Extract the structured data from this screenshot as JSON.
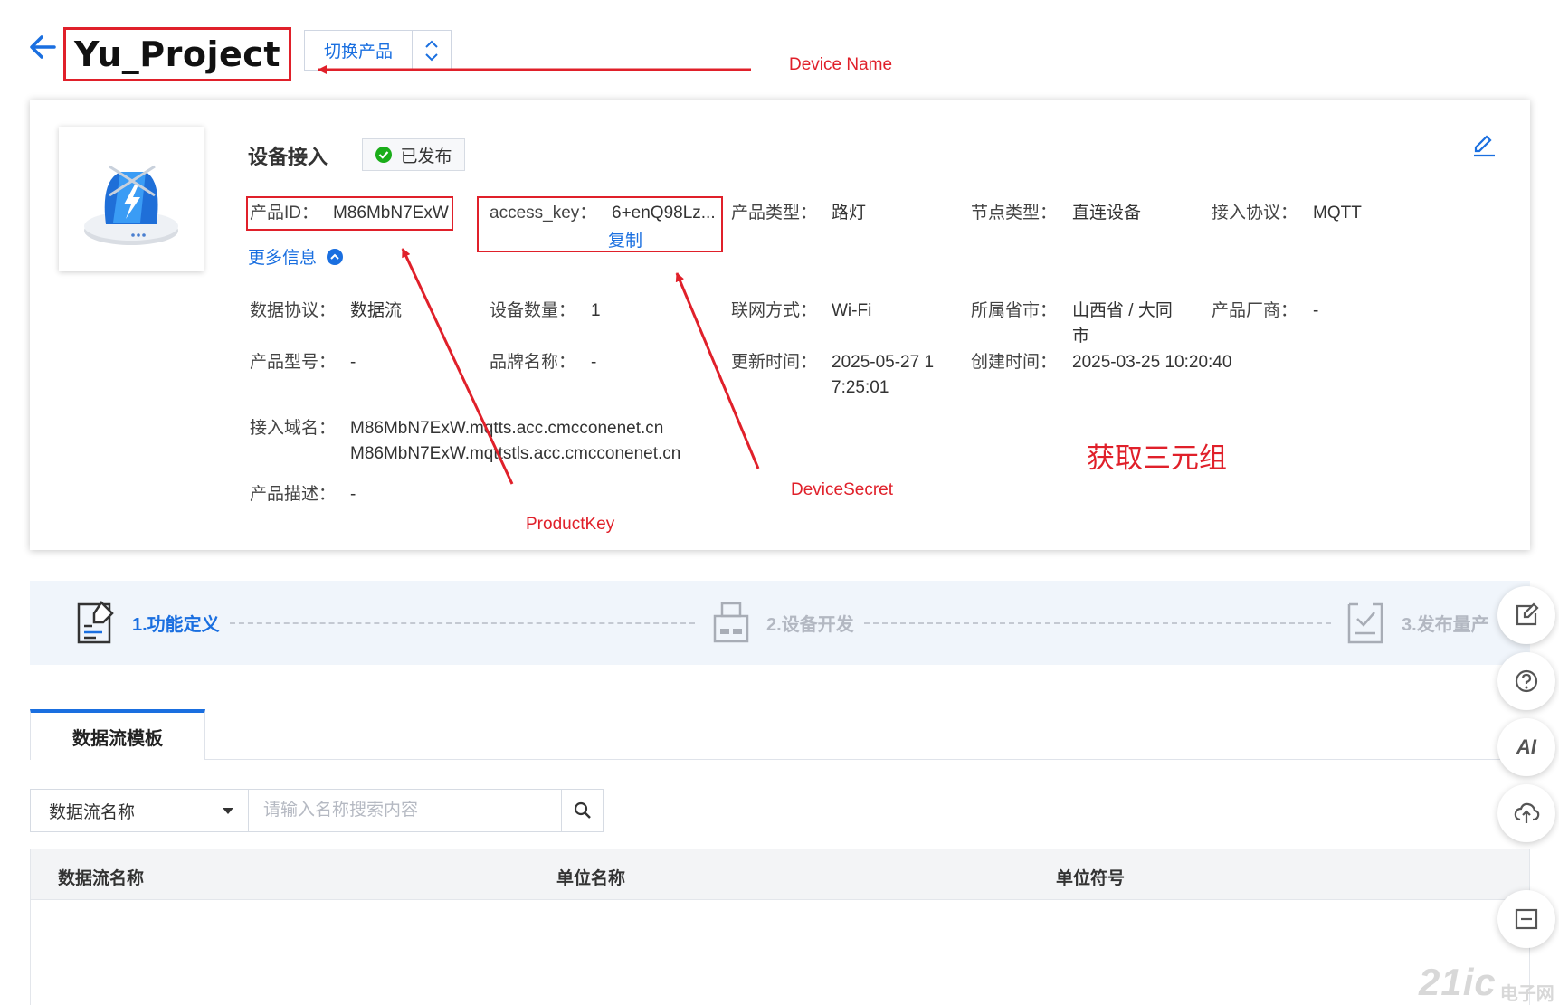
{
  "header": {
    "title": "Yu_Project",
    "switch_label": "切换产品"
  },
  "annotations": {
    "device_name": "Device Name",
    "product_key": "ProductKey",
    "device_secret": "DeviceSecret",
    "get_triple": "获取三元组",
    "color": "#e0202a"
  },
  "card": {
    "section_title": "设备接入",
    "status_badge": "已发布",
    "more_info": "更多信息",
    "copy": "复制",
    "fields": {
      "product_id": {
        "label": "产品ID：",
        "value": "M86MbN7ExW"
      },
      "access_key": {
        "label": "access_key：",
        "value": "6+enQ98Lz..."
      },
      "product_type": {
        "label": "产品类型：",
        "value": "路灯"
      },
      "node_type": {
        "label": "节点类型：",
        "value": "直连设备"
      },
      "protocol": {
        "label": "接入协议：",
        "value": "MQTT"
      },
      "data_protocol": {
        "label": "数据协议：",
        "value": "数据流"
      },
      "device_count": {
        "label": "设备数量：",
        "value": "1"
      },
      "network": {
        "label": "联网方式：",
        "value": "Wi-Fi"
      },
      "region": {
        "label": "所属省市：",
        "value": "山西省 / 大同市"
      },
      "vendor": {
        "label": "产品厂商：",
        "value": "-"
      },
      "model": {
        "label": "产品型号：",
        "value": "-"
      },
      "brand": {
        "label": "品牌名称：",
        "value": "-"
      },
      "updated": {
        "label": "更新时间：",
        "value": "2025-05-27 17:25:01"
      },
      "created": {
        "label": "创建时间：",
        "value": "2025-03-25 10:20:40"
      },
      "domain": {
        "label": "接入域名：",
        "value1": "M86MbN7ExW.mqtts.acc.cmcconenet.cn",
        "value2": "M86MbN7ExW.mqttstls.acc.cmcconenet.cn"
      },
      "description": {
        "label": "产品描述：",
        "value": "-"
      }
    }
  },
  "steps": [
    {
      "label": "1.功能定义",
      "state": "active"
    },
    {
      "label": "2.设备开发",
      "state": "inactive"
    },
    {
      "label": "3.发布量产",
      "state": "inactive"
    }
  ],
  "tabs": {
    "active": "数据流模板"
  },
  "search": {
    "select_value": "数据流名称",
    "placeholder": "请输入名称搜索内容"
  },
  "table": {
    "columns": [
      "数据流名称",
      "单位名称",
      "单位符号"
    ]
  },
  "float_tools": {
    "ai_label": "AI"
  },
  "watermark": {
    "main": "21ic",
    "sub": "电子网"
  },
  "colors": {
    "accent": "#1a6fe0",
    "success": "#1aad19",
    "inactive": "#b3b8c2"
  }
}
